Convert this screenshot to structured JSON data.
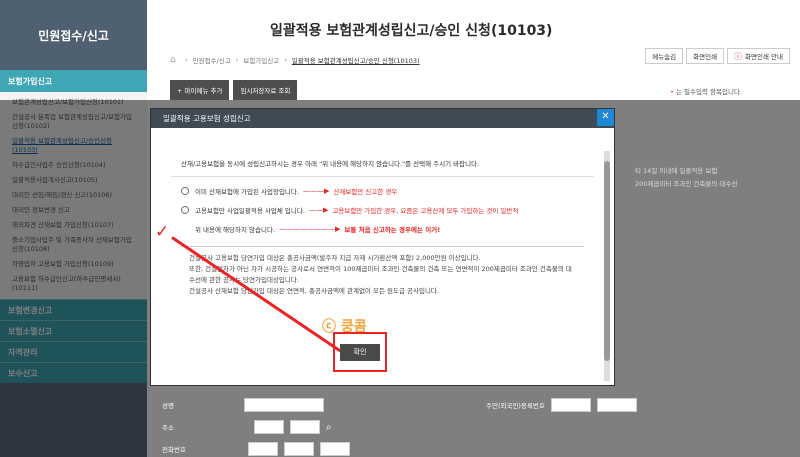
{
  "sidebar": {
    "title": "민원접수/신고",
    "section1": "보험가입신고",
    "items": [
      "보험관계성립신고/보험가입신청(10101)",
      "건설공사 분폭업 보험관계성립신고/보험가입 신청(10102)",
      "일괄적용 보험관계성립신고/승인신청(10103)",
      "하수급인사업주 승인신청(10104)",
      "일괄적용사업개시신고(10105)",
      "대리인 선임/해임/갱신 신고(10106)",
      "대리인 정보변경 신고",
      "해외파견 산재보험 가입신청(10107)",
      "중소기업사업주 및 가족종사자 산재보험가입신청(10108)",
      "자영업자 고용보험 가입신청(10109)",
      "고용보험 하수급인신고(하수급인명세서)(10111)"
    ],
    "sections": [
      "보험변경신고",
      "보험소멸신고",
      "자격관리",
      "보수신고"
    ]
  },
  "header": {
    "title": "일괄적용 보험관계성립신고/승인 신청(10103)",
    "breadcrumb": [
      "민원접수/신고",
      "보험가입신고",
      "일괄적용 보험관계성립신고/승인 신청(10103)"
    ],
    "btn_menu": "메뉴숨김",
    "btn_print": "화면인쇄",
    "btn_print_guide": "화면인쇄 안내",
    "btn_mymenu": "+ 마이메뉴 추가",
    "btn_temp": "임시저장자료 조회",
    "required": "는 필수입력 항목입니다."
  },
  "background": {
    "line1": "티 14일 이내에 일괄적용 보험",
    "line2": "200제곱미터 조과인 건축물의 대수선",
    "label_name": "성명",
    "label_addr": "주소",
    "label_phone": "전화번호",
    "label_id": "주민(외국인)등록번호"
  },
  "modal": {
    "title": "일괄적용 고용보험 성립신고",
    "intro": "산재/고용보험을 동시에 성립신고하시는 경우 아래 \"위 내용에 해당하지 않습니다.\"를 선택해 주시기 바랍니다.",
    "opt1": "이미 산재보험에 가입된 사업장입니다.",
    "opt1_note": "산재보험만 신고한 경우",
    "opt2": "고용보험만 사업일괄적용 사업체 입니다.",
    "opt2_note": "고용보험만 가입한 경우, 요즘은 고용산재 모두 가입하는 것이 일반적",
    "opt3": "위 내용에 해당하지 않습니다.",
    "opt3_note": "보통 처음 신고하는 경우에는 이거!",
    "info": [
      "건설공사 고용보험 당연가입 대상은 총공사금액(발주자 지급 자재 시가환산액 포함) 2,000만원 이상입니다.",
      "또한, 건설업자가 아닌 자가 시공하는 공사로서 연면적이 100제곱미터 조과인 건축물의 건축 또는 연면적이 200제곱미터 조과인 건축물의 대수선에 관한 공사는 당연가입대상입니다.",
      "건설공사 산재보험 당연가입 대상은 연면적, 총공사금액에 관계없이 모든 원도급 공사입니다."
    ],
    "watermark": "ⓒ 쿵콤",
    "confirm": "확인"
  }
}
